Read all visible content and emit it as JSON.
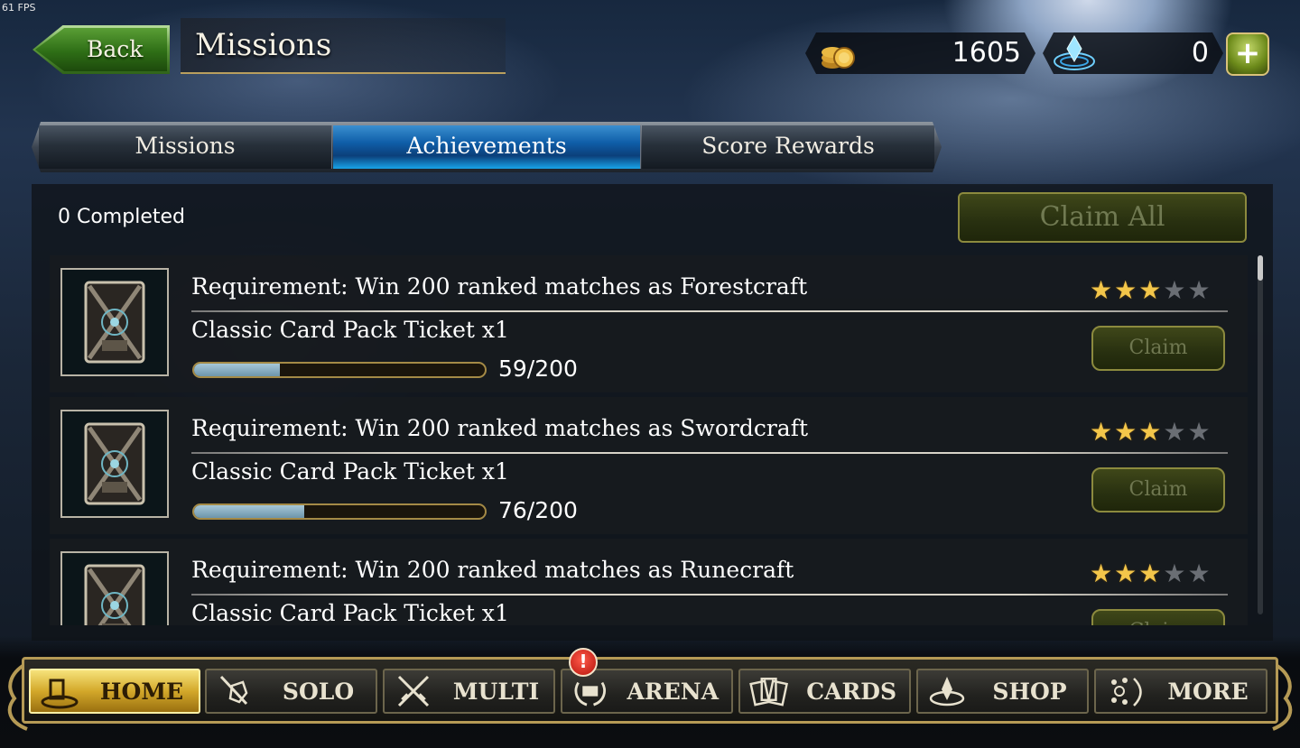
{
  "fps": "61 FPS",
  "header": {
    "back_label": "Back",
    "title": "Missions"
  },
  "currency": {
    "gold": "1605",
    "crystals": "0",
    "add_symbol": "+"
  },
  "tabs": [
    {
      "label": "Missions",
      "active": false
    },
    {
      "label": "Achievements",
      "active": true
    },
    {
      "label": "Score Rewards",
      "active": false
    }
  ],
  "panel": {
    "completed_text": "0 Completed",
    "claim_all_label": "Claim All"
  },
  "achievements": [
    {
      "requirement": "Requirement: Win 200 ranked matches as Forestcraft",
      "reward": "Classic Card Pack Ticket x1",
      "progress_text": "59/200",
      "progress_fraction": 0.295,
      "stars_filled": 3,
      "stars_total": 5,
      "claim_label": "Claim"
    },
    {
      "requirement": "Requirement: Win 200 ranked matches as Swordcraft",
      "reward": "Classic Card Pack Ticket x1",
      "progress_text": "76/200",
      "progress_fraction": 0.38,
      "stars_filled": 3,
      "stars_total": 5,
      "claim_label": "Claim"
    },
    {
      "requirement": "Requirement: Win 200 ranked matches as Runecraft",
      "reward": "Classic Card Pack Ticket x1",
      "stars_filled": 3,
      "stars_total": 5,
      "claim_label": "Claim"
    }
  ],
  "nav": [
    {
      "label": "HOME",
      "icon": "home-icon",
      "active": true
    },
    {
      "label": "SOLO",
      "icon": "solo-sword-shield-icon",
      "active": false
    },
    {
      "label": "MULTI",
      "icon": "multi-crossed-swords-icon",
      "active": false
    },
    {
      "label": "ARENA",
      "icon": "arena-laurel-icon",
      "active": false,
      "alert": "!"
    },
    {
      "label": "CARDS",
      "icon": "cards-icon",
      "active": false
    },
    {
      "label": "SHOP",
      "icon": "shop-icon",
      "active": false
    },
    {
      "label": "MORE",
      "icon": "more-icon",
      "active": false
    }
  ],
  "colors": {
    "active_tab": "#0f5ea8",
    "star_on": "#f3c64a",
    "star_off": "#6a6e74",
    "claim_disabled": "#283010",
    "nav_active": "#d3a82a"
  }
}
